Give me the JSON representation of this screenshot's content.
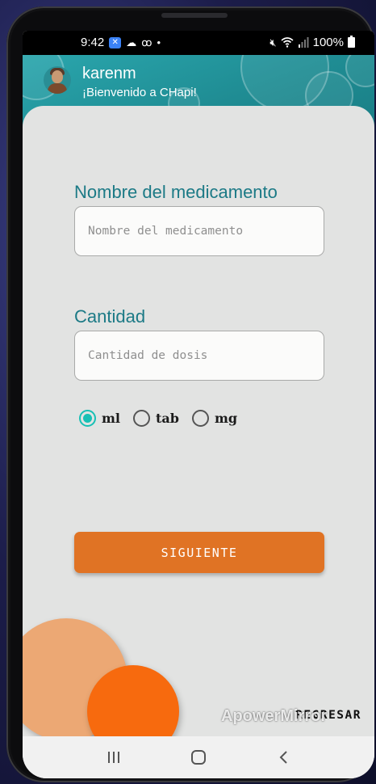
{
  "status_bar": {
    "time": "9:42",
    "battery": "100%",
    "icons": [
      "apowermirror-icon",
      "cloud-icon",
      "voicemail-icon",
      "dot-icon",
      "mute-icon",
      "wifi-icon",
      "signal-icon",
      "battery-icon"
    ]
  },
  "header": {
    "username": "karenm",
    "welcome": "¡Bienvenido a CHapi!",
    "accent": "#2aa6ad"
  },
  "form": {
    "name_label": "Nombre del medicamento",
    "name_placeholder": "Nombre del medicamento",
    "name_value": "",
    "quantity_label": "Cantidad",
    "quantity_placeholder": "Cantidad de dosis",
    "quantity_value": "",
    "units": [
      {
        "label": "ml",
        "checked": true
      },
      {
        "label": "tab",
        "checked": false
      },
      {
        "label": "mg",
        "checked": false
      }
    ]
  },
  "buttons": {
    "next": "SIGUIENTE",
    "back": "REGRESAR"
  },
  "watermark": "ApowerMirror",
  "colors": {
    "primary_button": "#e07324",
    "label_teal": "#1c7a86",
    "radio_checked": "#18c0b5"
  }
}
